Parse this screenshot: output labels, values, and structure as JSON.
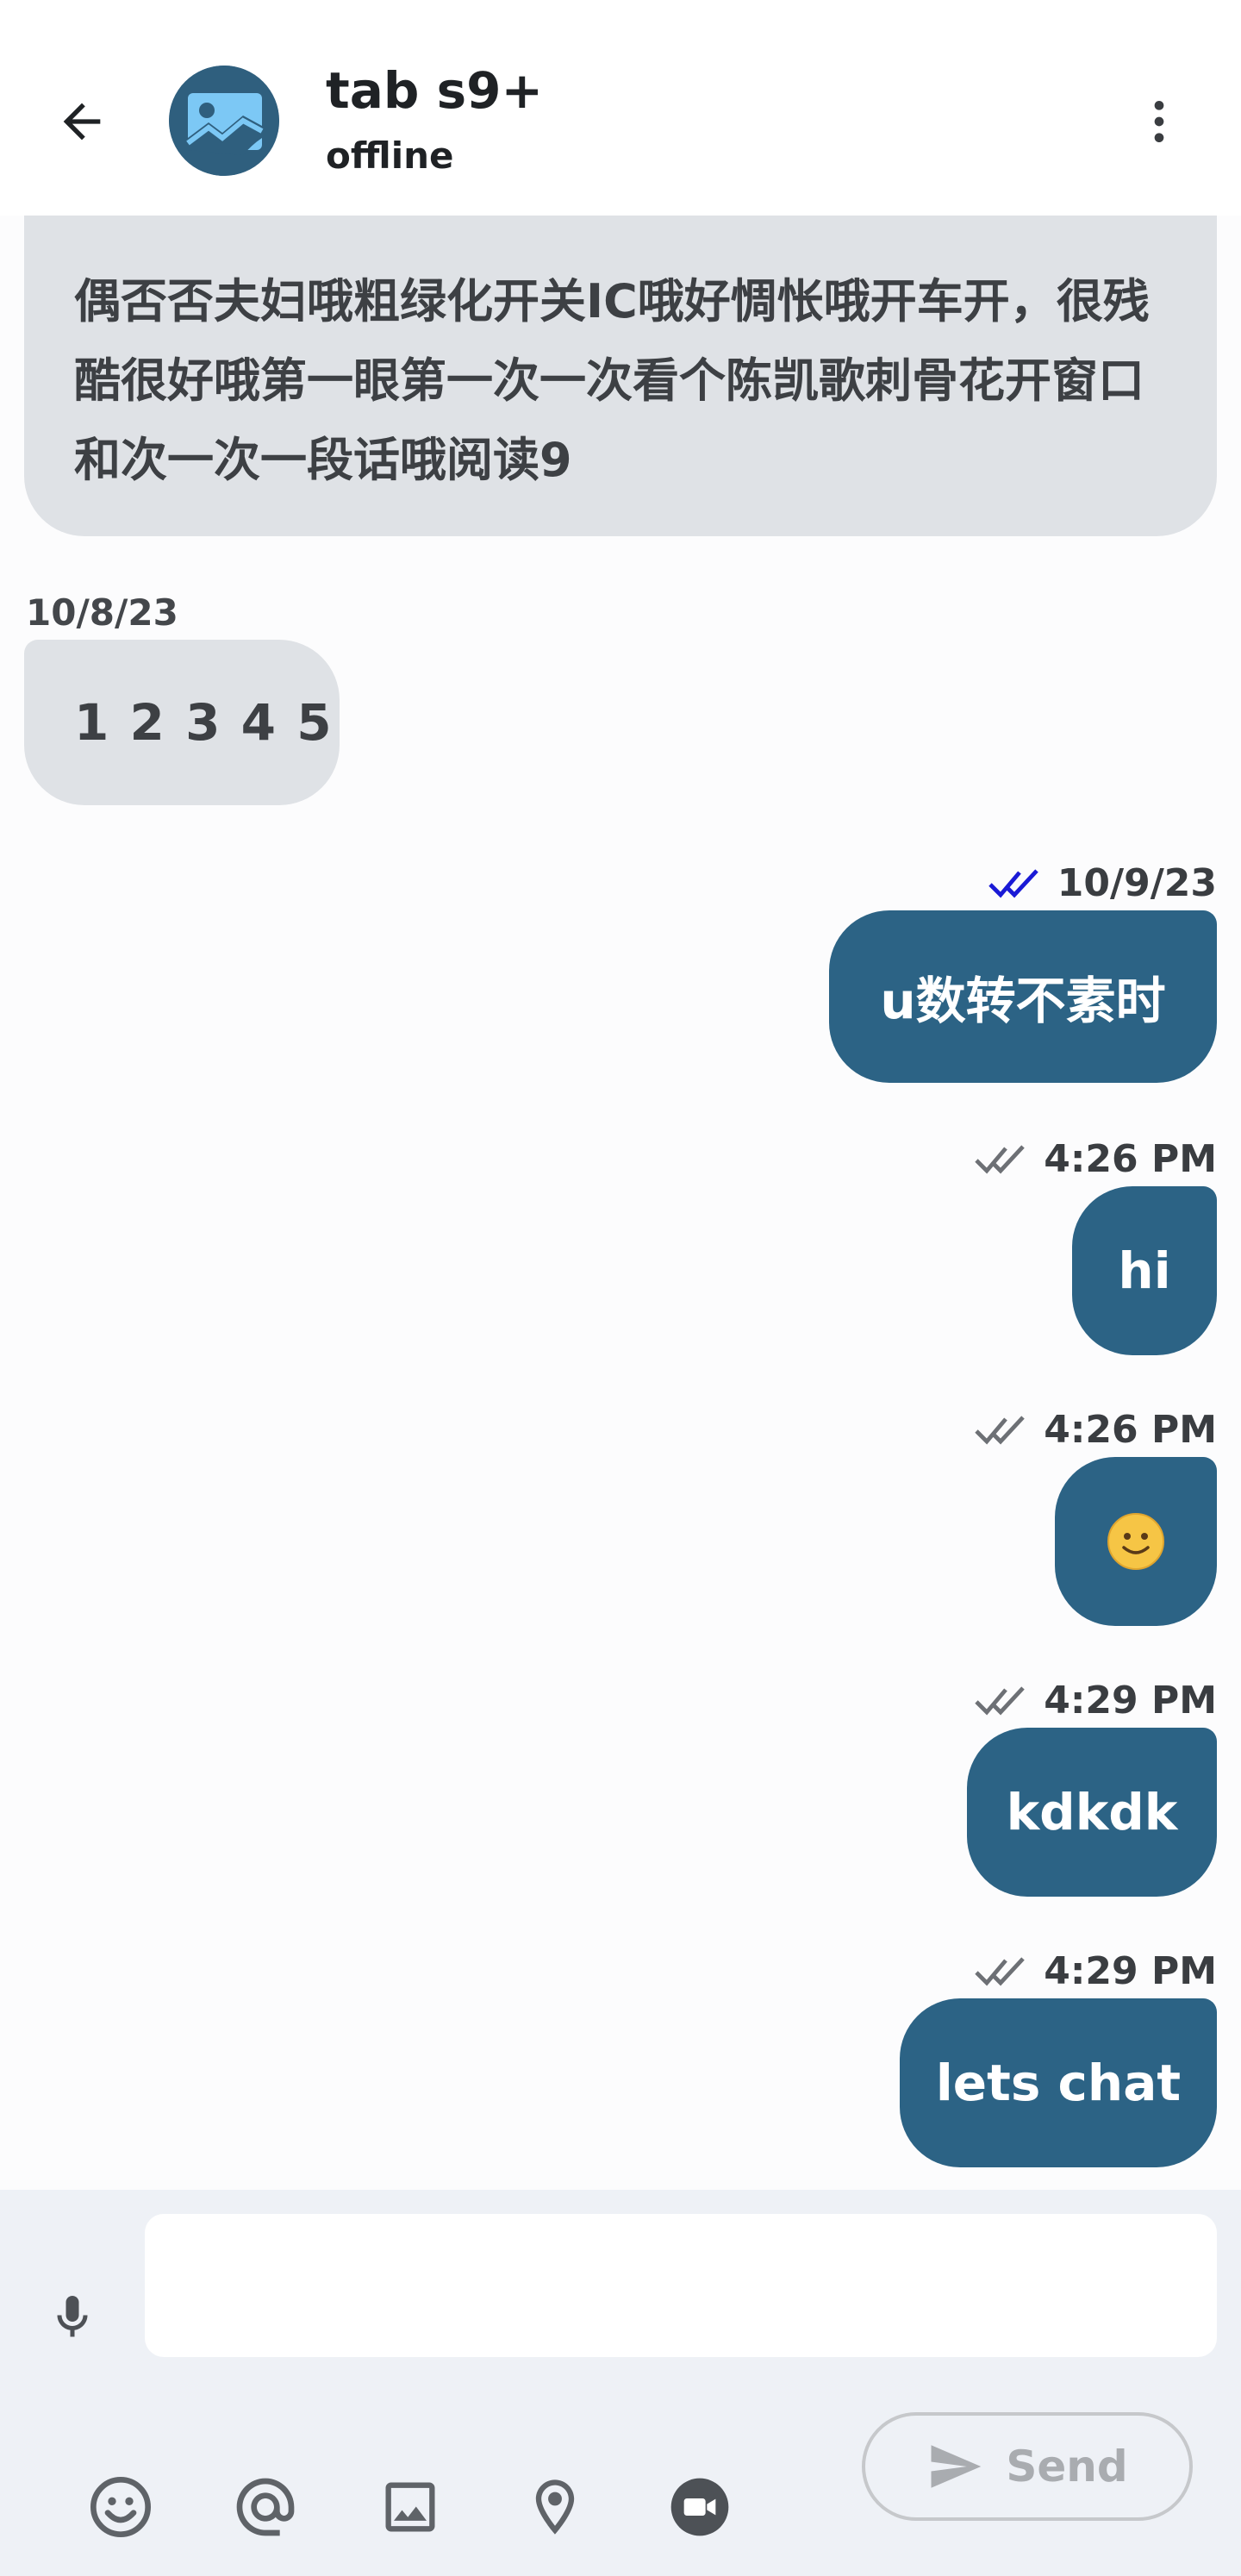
{
  "header": {
    "title": "tab s9+",
    "status": "offline",
    "back_icon": "arrow-left-icon",
    "menu_icon": "more-vertical-icon",
    "avatar_icon": "image-placeholder-icon"
  },
  "messages": [
    {
      "direction": "incoming",
      "text": "偶否否夫妇哦粗绿化开关IC哦好惆怅哦开车开，很残酷很好哦第一眼第一次一次看个陈凯歌刺骨花开窗口和次一次一段话哦阅读9"
    },
    {
      "direction": "incoming",
      "date": "10/8/23",
      "text": "1 2 3 4 5"
    },
    {
      "direction": "outgoing",
      "time": "10/9/23",
      "status": "read",
      "text": "u数转不素时"
    },
    {
      "direction": "outgoing",
      "time": "4:26 PM",
      "status": "delivered",
      "text": "hi"
    },
    {
      "direction": "outgoing",
      "time": "4:26 PM",
      "status": "delivered",
      "text": "🙂"
    },
    {
      "direction": "outgoing",
      "time": "4:29 PM",
      "status": "delivered",
      "text": "kdkdk"
    },
    {
      "direction": "outgoing",
      "time": "4:29 PM",
      "status": "delivered",
      "text": "lets chat"
    }
  ],
  "composer": {
    "input_value": "",
    "input_placeholder": "",
    "send_label": "Send",
    "tools": [
      "microphone-icon",
      "emoji-icon",
      "at-mention-icon",
      "image-icon",
      "location-pin-icon",
      "video-icon"
    ]
  },
  "colors": {
    "outgoing_bubble": "#2c6385",
    "incoming_bubble": "#dfe2e6",
    "read_tick": "#1a1ad6",
    "delivered_tick": "#6d7075",
    "composer_bg": "#eef1f6"
  }
}
